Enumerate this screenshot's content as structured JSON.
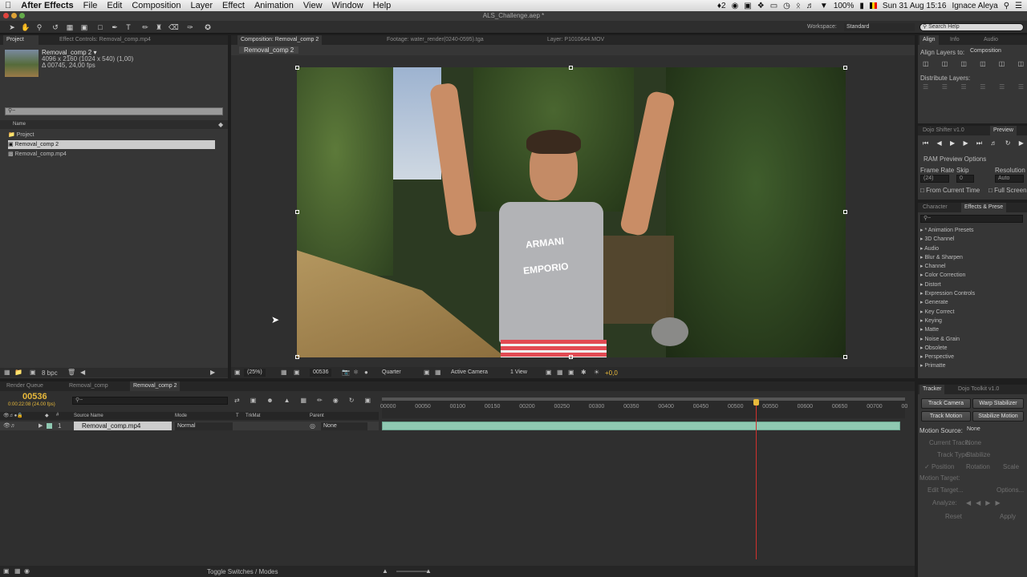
{
  "menubar": {
    "apple": "",
    "app": "After Effects",
    "items": [
      "File",
      "Edit",
      "Composition",
      "Layer",
      "Effect",
      "Animation",
      "View",
      "Window",
      "Help"
    ],
    "adobe_badge": "2",
    "battery": "100%",
    "clock": "Sun 31 Aug  15:16",
    "user": "Ignace Aleya"
  },
  "window": {
    "title": "ALS_Challenge.aep *"
  },
  "workspace": {
    "label": "Workspace:",
    "value": "Standard",
    "search_placeholder": "Search Help"
  },
  "project": {
    "tab": "Project",
    "effect_controls": "Effect Controls: Removal_comp.mp4",
    "comp_name": "Removal_comp 2 ▾",
    "dimensions": "4096 x 2160  (1024 x 540) (1,00)",
    "duration": "Δ 00745, 24,00 fps",
    "column_name": "Name",
    "items": [
      {
        "label": "Project",
        "type": "folder"
      },
      {
        "label": "Removal_comp 2",
        "type": "comp"
      },
      {
        "label": "Removal_comp.mp4",
        "type": "footage"
      }
    ],
    "bpc": "8 bpc"
  },
  "comp_viewer": {
    "tabs": [
      "Composition: Removal_comp 2",
      "Footage: water_render(0240-0595).tga",
      "Layer: P1010644.MOV"
    ],
    "sub_tab": "Removal_comp 2",
    "zoom": "(25%)",
    "timecode": "00536",
    "resolution": "Quarter",
    "camera": "Active Camera",
    "views": "1 View",
    "offset": "+0,0",
    "shirt_text_1": "ARMANI",
    "shirt_text_2": "EMPORIO"
  },
  "align": {
    "tabs": [
      "Align",
      "Info",
      "Audio"
    ],
    "align_to_label": "Align Layers to:",
    "align_to_value": "Composition",
    "distribute_label": "Distribute Layers:"
  },
  "preview": {
    "tabs": [
      "Dojo Shifter v1.0",
      "Preview"
    ],
    "ram_options": "RAM Preview Options",
    "frame_rate_label": "Frame Rate",
    "skip_label": "Skip",
    "resolution_label": "Resolution",
    "frame_rate": "(24)",
    "skip": "0",
    "resolution": "Auto",
    "from_current": "From Current Time",
    "full_screen": "Full Screen"
  },
  "effects": {
    "tabs": [
      "Character",
      "Effects & Prese"
    ],
    "items": [
      "* Animation Presets",
      "3D Channel",
      "Audio",
      "Blur & Sharpen",
      "Channel",
      "Color Correction",
      "Distort",
      "Expression Controls",
      "Generate",
      "Key Correct",
      "Keying",
      "Matte",
      "Noise & Grain",
      "Obsolete",
      "Perspective",
      "Primatte"
    ]
  },
  "timeline": {
    "tabs": [
      "Render Queue",
      "Removal_comp",
      "Removal_comp 2"
    ],
    "timecode": "00536",
    "timecode_sub": "0:00:22:08 (24.00 fps)",
    "columns": {
      "source": "Source Name",
      "mode": "Mode",
      "t": "T",
      "trkmat": "TrkMat",
      "parent": "Parent"
    },
    "layer": {
      "index": "1",
      "name": "Removal_comp.mp4",
      "mode": "Normal",
      "parent": "None"
    },
    "ruler": [
      "00000",
      "00050",
      "00100",
      "00150",
      "00200",
      "00250",
      "00300",
      "00350",
      "00400",
      "00450",
      "00500",
      "00550",
      "00600",
      "00650",
      "00700",
      "00"
    ],
    "toggle": "Toggle Switches / Modes",
    "playhead_frame": 536,
    "total_frames": 745
  },
  "tracker": {
    "tabs": [
      "Tracker",
      "Dojo Toolkit v1.0"
    ],
    "track_camera": "Track Camera",
    "warp_stabilizer": "Warp Stabilizer",
    "track_motion": "Track Motion",
    "stabilize_motion": "Stabilize Motion",
    "motion_source_label": "Motion Source:",
    "motion_source": "None",
    "current_track_label": "Current Track:",
    "current_track": "None",
    "track_type_label": "Track Type:",
    "track_type": "Stabilize",
    "position": "Position",
    "rotation": "Rotation",
    "scale": "Scale",
    "motion_target_label": "Motion Target:",
    "edit_target": "Edit Target...",
    "options": "Options...",
    "analyze": "Analyze:",
    "reset": "Reset",
    "apply": "Apply"
  },
  "colors": {
    "accent_yellow": "#e8b93b",
    "timeline_bar": "#8fc9b2",
    "playhead": "#d0312d",
    "selection": "#cccccc"
  }
}
